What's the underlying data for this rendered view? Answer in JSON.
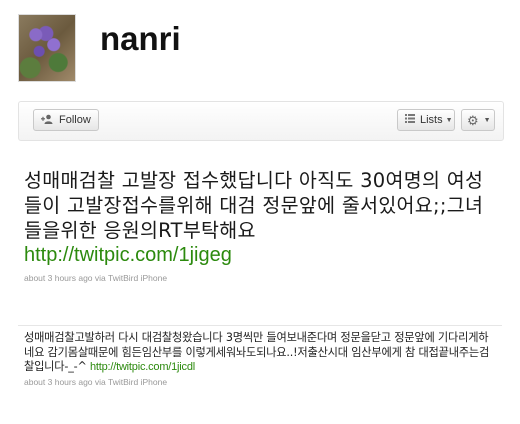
{
  "profile": {
    "screen_name": "nanri",
    "avatar_icon": "violet-flowers-avatar"
  },
  "toolbar": {
    "follow_label": "Follow",
    "follow_icon": "add-person-icon",
    "lists_label": "Lists",
    "lists_icon": "list-icon",
    "gear_icon": "gear-icon"
  },
  "tweets": [
    {
      "text": "성매매검찰 고발장 접수했답니다 아직도 30여명의 여성들이 고발장접수를위해 대검 정문앞에 줄서있어요;;그녀들을위한 응원의RT부탁해요",
      "link": "http://twitpic.com/1jigeg",
      "time": "about 3 hours ago",
      "via": "via",
      "source": "TwitBird iPhone"
    },
    {
      "text": "성매매검찰고발하러 다시 대검찰청왔습니다 3명씩만 들여보내준다며 정문을닫고 정문앞에 기다리게하네요 감기몸살때문에 힘든임산부를 이렇게세워놔도되나요..!저출산시대 임산부에게 참 대접끝내주는검찰입니다-_-^ ",
      "link": "http://twitpic.com/1jicdl",
      "time": "about 3 hours ago",
      "via": "via",
      "source": "TwitBird iPhone"
    }
  ],
  "colors": {
    "link_green": "#2c8a0e",
    "meta_gray": "#999999"
  }
}
